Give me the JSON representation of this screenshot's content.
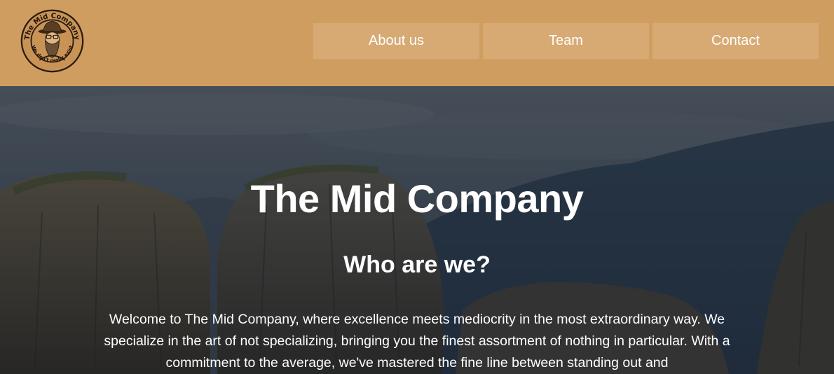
{
  "logo": {
    "name": "The Mid Company",
    "tagline": "We don't really exist",
    "icon": "bearded-man-logo-icon"
  },
  "nav": {
    "items": [
      {
        "label": "About us"
      },
      {
        "label": "Team"
      },
      {
        "label": "Contact"
      }
    ]
  },
  "hero": {
    "title": "The Mid Company",
    "subtitle": "Who are we?",
    "text": "Welcome to The Mid Company, where excellence meets mediocrity in the most extraordinary way. We specialize in the art of not specializing, bringing you the finest assortment of nothing in particular. With a commitment to the average, we've mastered the fine line between standing out and"
  },
  "colors": {
    "header_bg": "#d09d61",
    "nav_button_bg": "#d7aa74",
    "text": "#ffffff"
  }
}
